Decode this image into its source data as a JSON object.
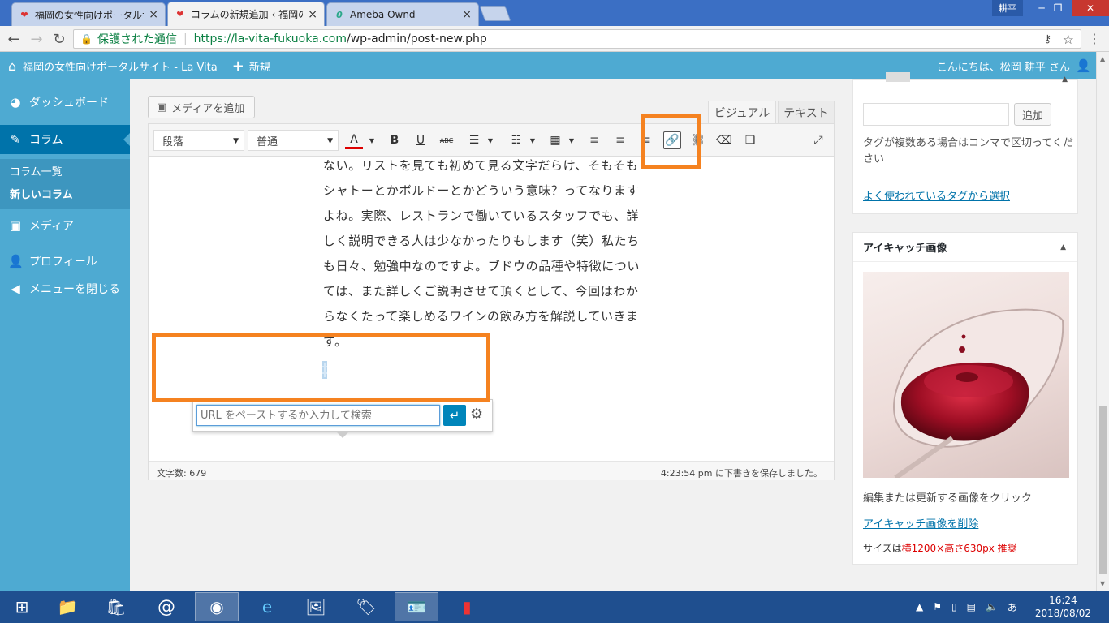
{
  "browser": {
    "tabs": [
      {
        "title": "福岡の女性向けポータルサイ",
        "icon": "heart-favicon"
      },
      {
        "title": "コラムの新規追加 ‹ 福岡の",
        "icon": "heart-favicon"
      },
      {
        "title": "Ameba Ownd",
        "icon": "ameba-favicon"
      }
    ],
    "window_user": "耕平",
    "secure_label": "保護された通信",
    "url_host": "https://la-vita-fukuoka.com",
    "url_path": "/wp-admin/post-new.php"
  },
  "adminbar": {
    "site_name": "福岡の女性向けポータルサイト - La Vita",
    "new_label": "新規",
    "greeting": "こんにちは、松岡 耕平 さん"
  },
  "sidebar": {
    "items": [
      {
        "label": "ダッシュボード",
        "icon": "dashboard-icon"
      },
      {
        "label": "コラム",
        "icon": "edit-icon"
      },
      {
        "label": "メディア",
        "icon": "media-icon"
      },
      {
        "label": "プロフィール",
        "icon": "user-icon"
      },
      {
        "label": "メニューを閉じる",
        "icon": "collapse-icon"
      }
    ],
    "submenu": [
      "コラム一覧",
      "新しいコラム"
    ]
  },
  "editor": {
    "add_media": "メディアを追加",
    "tab_visual": "ビジュアル",
    "tab_text": "テキスト",
    "format_select": "段落",
    "font_select": "普通",
    "body_lines": [
      "ない。リストを見ても初めて見る文字だらけ、そもそも",
      "シャトーとかボルドーとかどういう意味？ってなります",
      "よね。実際、レストランで働いているスタッフでも、詳",
      "しく説明できる人は少なかったりもします（笑）私たち",
      "も日々、勉強中なのですよ。ブドウの品種や特徴につい",
      "ては、また詳しくご説明させて頂くとして、今回はわか",
      "らなくたって楽しめるワインの飲み方を解説していきま",
      "す。"
    ],
    "link_placeholder": "URL をペーストするか入力して検索",
    "word_count": "文字数: 679",
    "saved_status": "4:23:54 pm に下書きを保存しました。"
  },
  "tags": {
    "add_button": "追加",
    "help": "タグが複数ある場合はコンマで区切ってください",
    "popular_link": "よく使われているタグから選択"
  },
  "featured_image": {
    "title": "アイキャッチ画像",
    "edit_hint": "編集または更新する画像をクリック",
    "remove_link": "アイキャッチ画像を削除",
    "size_prefix": "サイズは",
    "size_value": "横1200×高さ630px 推奨"
  },
  "taskbar": {
    "time": "16:24",
    "date": "2018/08/02",
    "ime": "あ"
  },
  "colors": {
    "wp_sidebar": "#4eaad2",
    "wp_active": "#0073aa",
    "highlight": "#f58220"
  }
}
